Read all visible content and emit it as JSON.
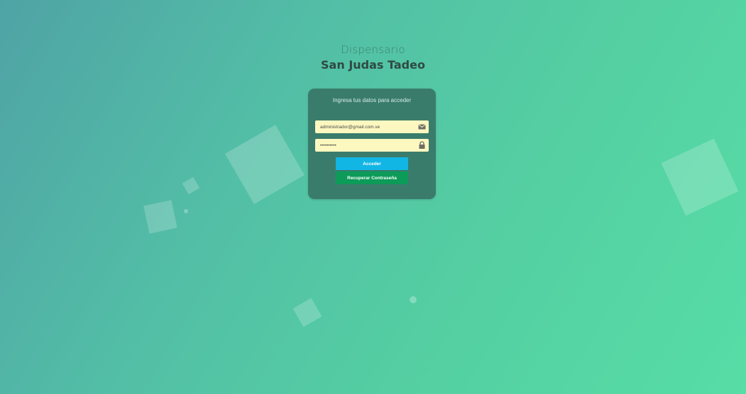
{
  "header": {
    "subtitle": "Dispensario",
    "title": "San Judas Tadeo"
  },
  "login_card": {
    "heading": "Ingresa tus datos para acceder",
    "email": {
      "value": "administrador@gmail.com.ve",
      "icon": "envelope-icon"
    },
    "password": {
      "value": "••••••••••",
      "icon": "lock-icon"
    },
    "login_button": "Acceder",
    "recover_button": "Recuperar Contraseña"
  },
  "colors": {
    "card_background": "#3a7c6c",
    "input_background": "#fdf8c0",
    "login_button": "#12b6e4",
    "recover_button": "#0c9b58",
    "title_text": "#2f4a43"
  }
}
